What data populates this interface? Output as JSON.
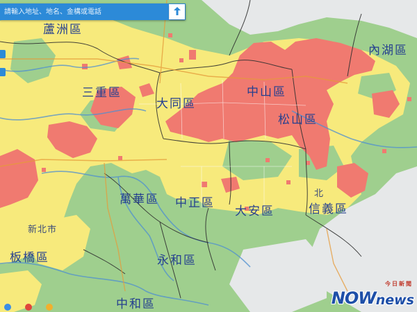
{
  "search": {
    "placeholder": "請輸入地址、地名、金構或電話"
  },
  "icons": {
    "search": "search-icon",
    "locate": "upload-arrow-icon"
  },
  "legend_colors": {
    "high": "#f07a70",
    "medium": "#f7ea7c",
    "low": "#9fcf8e"
  },
  "districts": [
    {
      "id": "luzhou",
      "label": "蘆洲區"
    },
    {
      "id": "neihu",
      "label": "內湖區"
    },
    {
      "id": "sanchong",
      "label": "三重區"
    },
    {
      "id": "datong",
      "label": "大同區"
    },
    {
      "id": "zhongshan",
      "label": "中山區"
    },
    {
      "id": "songshan",
      "label": "松山區"
    },
    {
      "id": "wanhua",
      "label": "萬華區"
    },
    {
      "id": "zhongzheng",
      "label": "中正區"
    },
    {
      "id": "daan",
      "label": "大安區"
    },
    {
      "id": "xinyi",
      "label": "信義區"
    },
    {
      "id": "banqiao",
      "label": "板橋區"
    },
    {
      "id": "yonghe",
      "label": "永和區"
    },
    {
      "id": "zhonghe",
      "label": "中和區"
    },
    {
      "id": "xinbei",
      "label": "新北市"
    },
    {
      "id": "bei",
      "label": "北"
    }
  ],
  "watermark": {
    "brand_a": "NOW",
    "brand_b": "news",
    "brand_cn": "今日新聞"
  }
}
